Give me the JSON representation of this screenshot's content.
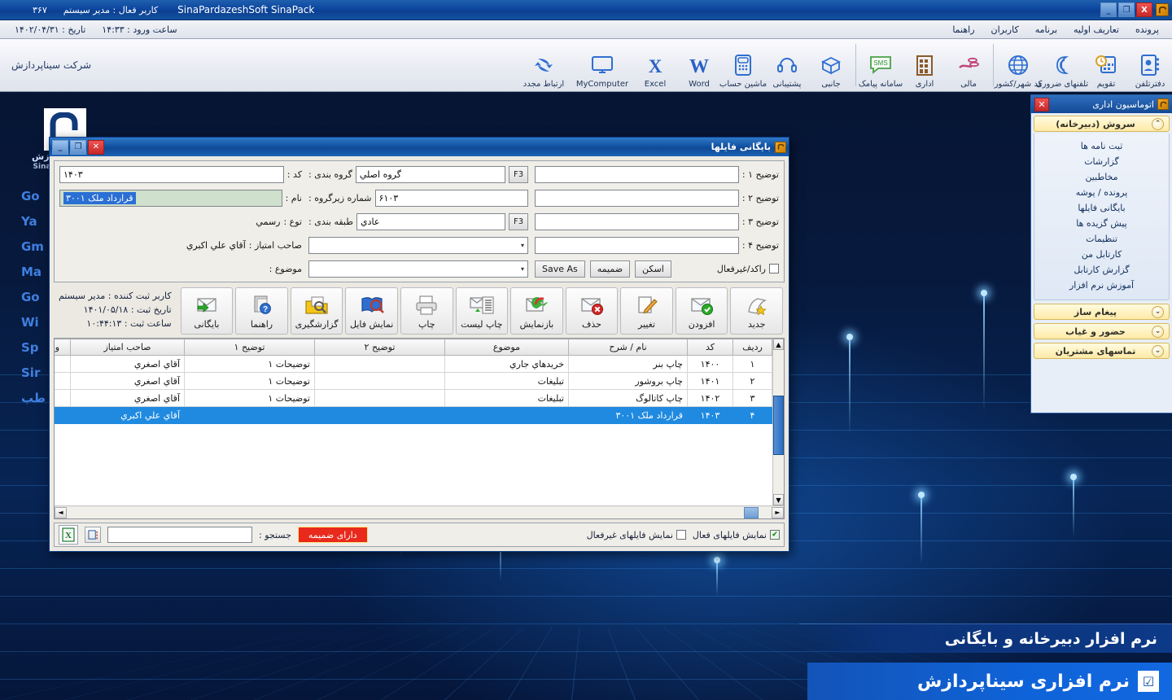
{
  "app": {
    "title": "SinaPardazeshSoft SinaPack",
    "active_user": "کاربر فعال : مدیر سیستم",
    "counter": "۳۶۷",
    "icon": "app-logo-icon",
    "min": "_",
    "max": "❐",
    "close": "X"
  },
  "menubar": {
    "items": [
      {
        "label": "پرونده"
      },
      {
        "label": "تعاریف اولیه"
      },
      {
        "label": "برنامه"
      },
      {
        "label": "کاربران"
      },
      {
        "label": "راهنما"
      }
    ],
    "login_time": "ساعت ورود : ۱۴:۳۳",
    "date": "تاریخ : ۱۴۰۲/۰۴/۳۱"
  },
  "toolbar": {
    "company": "شرکت سیناپردازش",
    "group_right": [
      {
        "label": "دفترتلفن",
        "icon": "contacts-book-icon"
      },
      {
        "label": "تقویم",
        "icon": "calendar-clock-icon"
      },
      {
        "label": "تلفنهای ضروری",
        "icon": "phone-icon"
      },
      {
        "label": "کد شهر/کشور",
        "icon": "globe-icon"
      }
    ],
    "group_mid": [
      {
        "label": "مالی",
        "icon": "hand-coins-icon"
      },
      {
        "label": "اداری",
        "icon": "office-building-icon"
      },
      {
        "label": "سامانه پیامک",
        "icon": "sms-bubble-icon"
      }
    ],
    "group_left": [
      {
        "label": "جانبی",
        "icon": "box-icon"
      },
      {
        "label": "پشتیبانی",
        "icon": "headset-icon"
      },
      {
        "label": "ماشین حساب",
        "icon": "calculator-icon"
      },
      {
        "label": "Word",
        "icon": "word-icon"
      },
      {
        "label": "Excel",
        "icon": "excel-icon"
      },
      {
        "label": "MyComputer",
        "icon": "monitor-icon"
      },
      {
        "label": "ارتباط مجدد",
        "icon": "reconnect-arrows-icon"
      }
    ]
  },
  "sidepanel": {
    "title": "اتوماسیون اداری",
    "close": "✕",
    "sections": [
      {
        "label": "سروش (دبیرخانه)",
        "expanded": true,
        "chevron": "⌃",
        "items": [
          "ثبت نامه ها",
          "گزارشات",
          "مخاطبین",
          "پرونده / پوشه",
          "بایگانی فایلها",
          "پیش گزیده ها",
          "تنظیمات",
          "کارتابل من",
          "گزارش کارتابل",
          "آموزش نرم افزار"
        ]
      },
      {
        "label": "پیغام ساز",
        "expanded": false,
        "chevron": "⌄",
        "items": []
      },
      {
        "label": "حضور و غیاب",
        "expanded": false,
        "chevron": "⌄",
        "items": []
      },
      {
        "label": "تماسهای مشتریان",
        "expanded": false,
        "chevron": "⌄",
        "items": []
      }
    ]
  },
  "dialog": {
    "title": "بایگانی فایلها",
    "icon": "app-logo-icon",
    "min": "_",
    "max": "❐",
    "close": "✕",
    "form": {
      "code_label": "کد :",
      "code_value": "۱۴۰۳",
      "name_label": "نام :",
      "name_value": "قرارداد ملک ۳۰۰۱",
      "type_label": "توع :",
      "type_value": "رسمي",
      "owner_label": "صاحب امتیاز :",
      "owner_value": "آقاي علي اکبري",
      "subject_label": "موضوع :",
      "subject_value": "",
      "group_label": "گروه بندی :",
      "group_value": "گروه اصلي",
      "group_key": "F3",
      "subgroup_label": "شماره زیرگروه :",
      "subgroup_value": "۶۱۰۳",
      "class_label": "طبقه بندی :",
      "class_value": "عادي",
      "class_key": "F3",
      "desc1_label": "توضیح ۱ :",
      "desc1_value": "",
      "desc2_label": "توضیح ۲ :",
      "desc2_value": "",
      "desc3_label": "توضیح ۳ :",
      "desc3_value": "",
      "desc4_label": "توضیح ۴ :",
      "desc4_value": "",
      "inactive_label": "راکد/غیرفعال",
      "inactive_checked": false,
      "btn_scan": "اسکن",
      "btn_attach": "ضمیمه",
      "btn_saveas": "Save As"
    },
    "actions": [
      {
        "label": "جدید",
        "icon": "new-document-star-icon"
      },
      {
        "label": "افزودن",
        "icon": "add-check-icon"
      },
      {
        "label": "تغییر",
        "icon": "edit-pencil-icon"
      },
      {
        "label": "حذف",
        "icon": "delete-x-icon"
      },
      {
        "label": "بازنمایش",
        "icon": "refresh-icon"
      },
      {
        "label": "چاپ لیست",
        "icon": "print-list-icon"
      },
      {
        "label": "چاپ",
        "icon": "printer-icon"
      },
      {
        "label": "نمایش فایل",
        "icon": "view-file-icon"
      },
      {
        "label": "گزارشگیری",
        "icon": "report-search-icon"
      },
      {
        "label": "راهنما",
        "icon": "help-question-icon"
      },
      {
        "label": "بایگانی",
        "icon": "archive-arrow-icon"
      }
    ],
    "info": {
      "registrar": "کاربر ثبت کننده : مدیر سیستم",
      "reg_date": "تاریخ ثبت : ۱۴۰۱/۰۵/۱۸",
      "reg_time": "ساعت ثبت : ۱۰:۴۴:۱۳"
    },
    "table": {
      "headers": [
        "ردیف",
        "کد",
        "نام / شرح",
        "موضوع",
        "توضیح ۲",
        "توضیح ۱",
        "صاحب امتیاز",
        "وضیح"
      ],
      "rows": [
        {
          "selected": false,
          "cells": [
            "۱",
            "۱۴۰۰",
            "چاپ بنر",
            "خریدهاي جاري",
            "",
            "توضیحات ۱",
            "آقاي اصغري",
            ""
          ]
        },
        {
          "selected": false,
          "cells": [
            "۲",
            "۱۴۰۱",
            "چاپ بروشور",
            "تبلیغات",
            "",
            "توضیحات ۱",
            "آقاي اصغري",
            ""
          ]
        },
        {
          "selected": false,
          "cells": [
            "۳",
            "۱۴۰۲",
            "چاپ کاتالوگ",
            "تبلیغات",
            "",
            "توضیحات ۱",
            "آقاي اصغري",
            ""
          ]
        },
        {
          "selected": true,
          "cells": [
            "۴",
            "۱۴۰۳",
            "قرارداد ملک ۳۰۰۱",
            "",
            "",
            "",
            "آقاي علي اکبري",
            ""
          ]
        }
      ]
    },
    "footer": {
      "show_active_label": "نمایش فایلهای فعال",
      "show_active_checked": true,
      "show_inactive_label": "نمایش فایلهای غیرفعال",
      "show_inactive_checked": false,
      "attach_filter_label": "دارای ضمیمه",
      "search_label": "جستجو :",
      "search_value": "",
      "excel_icon": "excel-export-icon",
      "grid_icon": "grid-settings-icon"
    }
  },
  "desktop": {
    "logo_caption_1": "پردازش",
    "logo_caption_2": "SinaPar",
    "links": [
      "Go",
      "Ya",
      "Gm",
      "Ma",
      "Go",
      "Wi",
      "Sp",
      "Sir",
      "طب"
    ],
    "watermark": "SinaPardazeshSoft",
    "banner_top": "نرم افزار دبیرخانه و بایگانی",
    "banner_bottom": "نرم افزاری سیناپردازش",
    "banner_icon": "checkbox-brand-icon"
  }
}
